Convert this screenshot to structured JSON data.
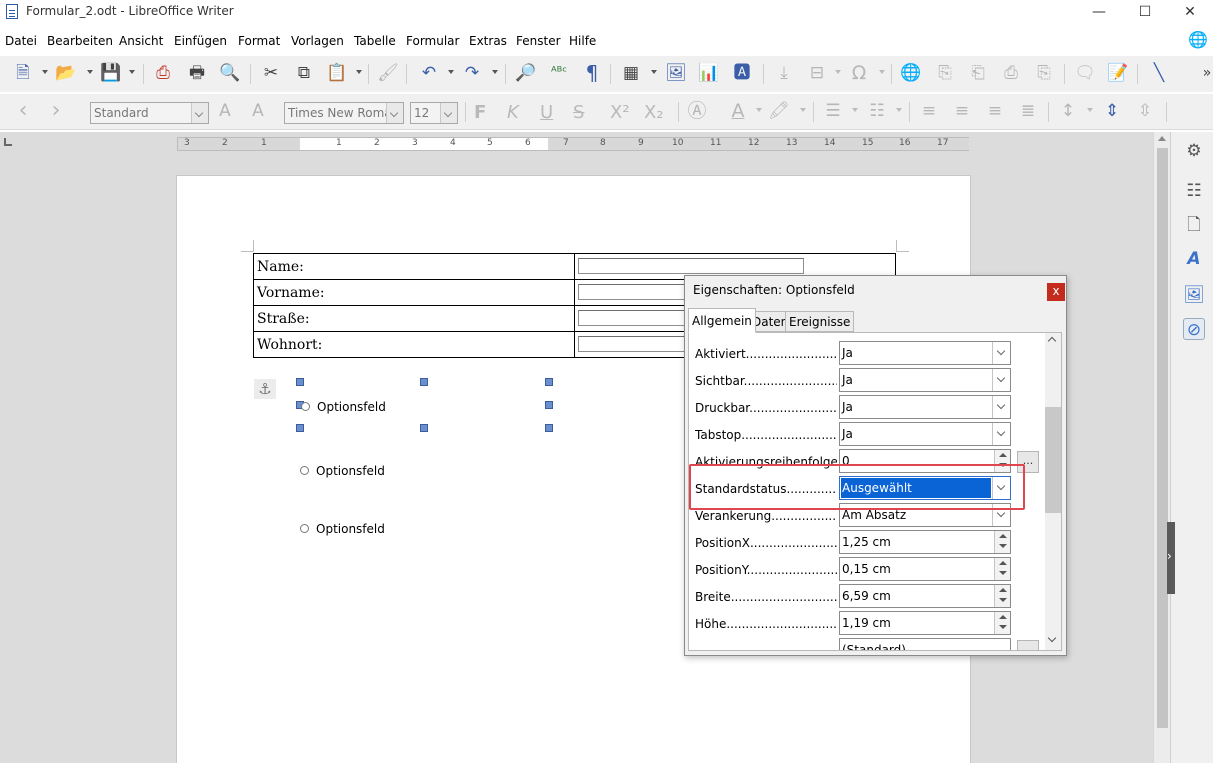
{
  "window": {
    "title": "Formular_2.odt - LibreOffice Writer",
    "minimize_glyph": "—",
    "maximize_glyph": "☐",
    "close_glyph": "✕"
  },
  "menu": [
    "Datei",
    "Bearbeiten",
    "Ansicht",
    "Einfügen",
    "Format",
    "Vorlagen",
    "Tabelle",
    "Formular",
    "Extras",
    "Fenster",
    "Hilfe"
  ],
  "formatting": {
    "paragraph_style": "Standard",
    "font_name": "Times New Roman",
    "font_size": "12",
    "bold": "F",
    "italic": "K",
    "underline": "U",
    "strike": "S",
    "superscript": "X²",
    "subscript": "X₂"
  },
  "ruler": {
    "labels": [
      "3",
      "2",
      "1",
      "1",
      "2",
      "3",
      "4",
      "5",
      "6",
      "7",
      "8",
      "9",
      "10",
      "11",
      "12",
      "13",
      "14",
      "15",
      "16",
      "17"
    ]
  },
  "document": {
    "table_rows": [
      {
        "label": "Name:"
      },
      {
        "label": "Vorname:"
      },
      {
        "label": "Straße:"
      },
      {
        "label": "Wohnort:"
      }
    ],
    "options": [
      "Optionsfeld",
      "Optionsfeld",
      "Optionsfeld"
    ],
    "anchor_glyph": "⚓"
  },
  "dialog": {
    "title": "Eigenschaften: Optionsfeld",
    "close_glyph": "x",
    "tabs": [
      "Allgemein",
      "Daten",
      "Ereignisse"
    ],
    "properties": [
      {
        "label": "Aktiviert.....................................",
        "value": "Ja",
        "kind": "dropdown"
      },
      {
        "label": "Sichtbar.....................................",
        "value": "Ja",
        "kind": "dropdown"
      },
      {
        "label": "Druckbar.....................................",
        "value": "Ja",
        "kind": "dropdown"
      },
      {
        "label": "Tabstop.....................................",
        "value": "Ja",
        "kind": "dropdown"
      },
      {
        "label": "Aktivierungsreihenfolge.......",
        "value": "0",
        "kind": "spin",
        "extra": "..."
      },
      {
        "label": "Standardstatus....................",
        "value": "Ausgewählt",
        "kind": "dropdown",
        "selected": true
      },
      {
        "label": "Verankerung..........................",
        "value": "Am Absatz",
        "kind": "dropdown"
      },
      {
        "label": "PositionX...............................",
        "value": "1,25 cm",
        "kind": "spin"
      },
      {
        "label": "PositionY...............................",
        "value": "0,15 cm",
        "kind": "spin"
      },
      {
        "label": "Breite.......................................",
        "value": "6,59 cm",
        "kind": "spin"
      },
      {
        "label": "Höhe.........................................",
        "value": "1,19 cm",
        "kind": "spin"
      },
      {
        "label": "",
        "value": "(Standard)",
        "kind": "spin",
        "extra": ""
      }
    ]
  },
  "colors": {
    "accent": "#0a64d6",
    "highlight_box": "#e0464e",
    "close_button": "#c42b1c"
  }
}
